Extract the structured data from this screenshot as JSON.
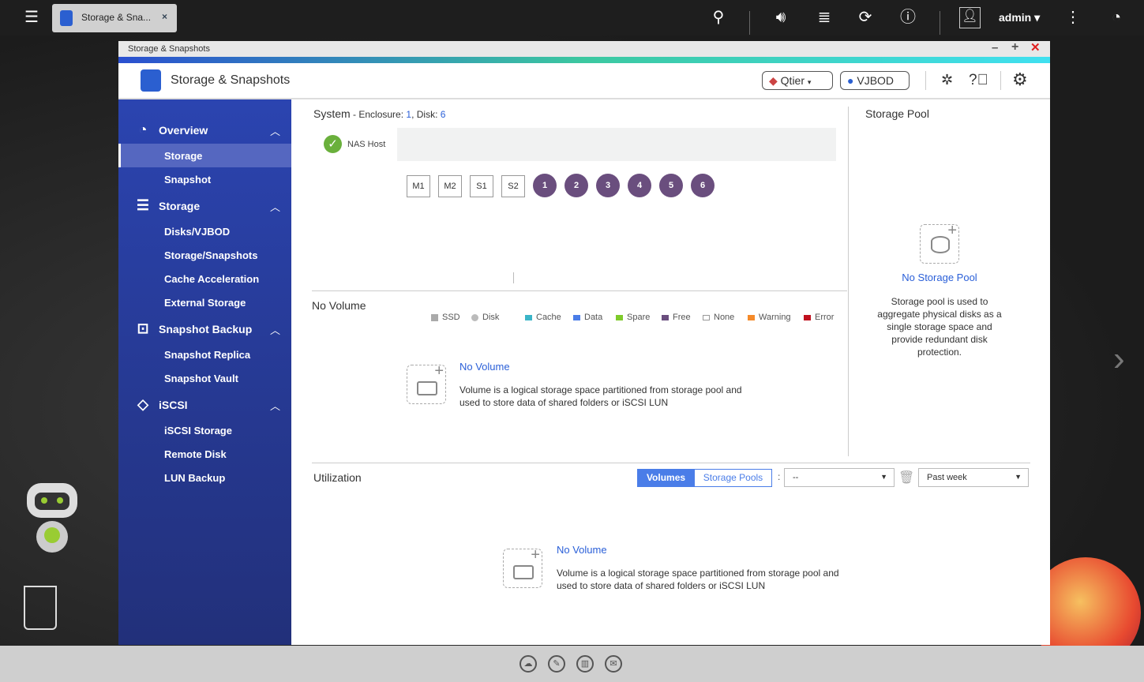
{
  "taskbar": {
    "tab_title": "Storage & Sna...",
    "user": "admin"
  },
  "window": {
    "titlebar": "Storage & Snapshots",
    "app_title": "Storage & Snapshots",
    "qtier": "Qtier",
    "vjbod": "VJBOD"
  },
  "sidebar": {
    "sections": [
      {
        "label": "Overview",
        "items": [
          "Storage",
          "Snapshot"
        ]
      },
      {
        "label": "Storage",
        "items": [
          "Disks/VJBOD",
          "Storage/Snapshots",
          "Cache Acceleration",
          "External Storage"
        ]
      },
      {
        "label": "Snapshot Backup",
        "items": [
          "Snapshot Replica",
          "Snapshot Vault"
        ]
      },
      {
        "label": "iSCSI",
        "items": [
          "iSCSI Storage",
          "Remote Disk",
          "LUN Backup"
        ]
      }
    ]
  },
  "system": {
    "title": "System",
    "enclosure_label": " - Enclosure: ",
    "enclosure": "1",
    "disk_label": ", Disk: ",
    "disk": "6",
    "host": "NAS Host",
    "slots": [
      "M1",
      "M2",
      "S1",
      "S2"
    ],
    "disks": [
      "1",
      "2",
      "3",
      "4",
      "5",
      "6"
    ],
    "legend": [
      {
        "label": "SSD",
        "color": "#aaaaaa"
      },
      {
        "label": "Disk",
        "color": "#bbbbbb"
      },
      {
        "label": "Cache",
        "color": "#3bb5c8"
      },
      {
        "label": "Data",
        "color": "#4a7de8"
      },
      {
        "label": "Spare",
        "color": "#7ecb2a"
      },
      {
        "label": "Free",
        "color": "#6a4e7e"
      },
      {
        "label": "None",
        "color": "#ffffff"
      },
      {
        "label": "Warning",
        "color": "#f58a2a"
      },
      {
        "label": "Error",
        "color": "#c0101e"
      }
    ]
  },
  "volume": {
    "title": "No Volume",
    "empty_title": "No Volume",
    "empty_desc1": "Volume is a logical storage space partitioned from storage pool and",
    "empty_desc2": "used to store data of shared folders or iSCSI LUN"
  },
  "pool": {
    "title": "Storage Pool",
    "empty_title": "No Storage Pool",
    "desc": [
      "Storage pool is used to",
      "aggregate physical disks as a",
      "single storage space and",
      "provide redundant disk",
      "protection."
    ]
  },
  "utilization": {
    "title": "Utilization",
    "tabs": [
      "Volumes",
      "Storage Pools"
    ],
    "colon": ":",
    "select_value": "--",
    "range": "Past week",
    "empty_title": "No Volume",
    "empty_desc1": "Volume is a logical storage space partitioned from storage pool and",
    "empty_desc2": "used to store data of shared folders or iSCSI LUN"
  }
}
